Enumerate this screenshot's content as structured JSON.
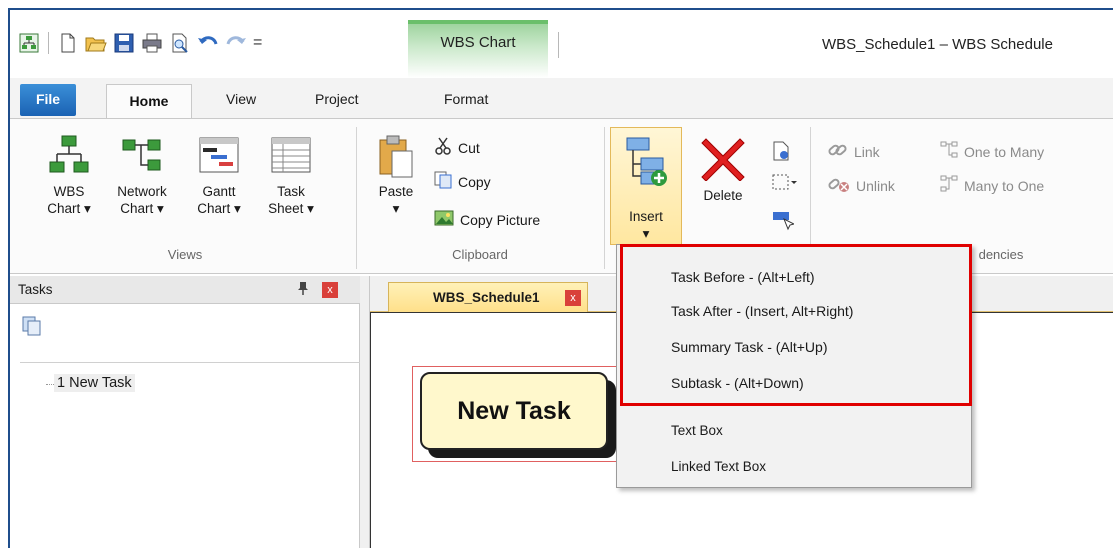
{
  "window": {
    "context_tab": "WBS Chart",
    "title": "WBS_Schedule1 – WBS Schedule"
  },
  "quick_access": {
    "icons": [
      "app-icon",
      "new-icon",
      "open-icon",
      "save-icon",
      "print-icon",
      "print-preview-icon",
      "undo-icon",
      "redo-icon"
    ],
    "more": "="
  },
  "ribbon_tabs": {
    "file": "File",
    "home": "Home",
    "view": "View",
    "project": "Project",
    "format": "Format"
  },
  "views_group": {
    "label": "Views",
    "wbs_chart": [
      "WBS",
      "Chart ▾"
    ],
    "network_chart": [
      "Network",
      "Chart ▾"
    ],
    "gantt_chart": [
      "Gantt",
      "Chart ▾"
    ],
    "task_sheet": [
      "Task",
      "Sheet ▾"
    ]
  },
  "clipboard_group": {
    "label": "Clipboard",
    "paste": "Paste",
    "paste_arrow": "▾",
    "cut": "Cut",
    "copy": "Copy",
    "copy_picture": "Copy Picture"
  },
  "insert_group": {
    "insert": "Insert",
    "insert_arrow": "▾",
    "delete": "Delete"
  },
  "dependencies_group": {
    "label": "dencies",
    "link": "Link",
    "unlink": "Unlink",
    "one_to_many": "One to Many",
    "many_to_one": "Many to One"
  },
  "tasks_panel": {
    "title": "Tasks",
    "pin": "ᵩ",
    "close": "x",
    "items": [
      "1 New Task"
    ]
  },
  "document": {
    "tab_label": "WBS_Schedule1",
    "tab_close": "x",
    "node_label": "New Task"
  },
  "insert_menu": {
    "items": [
      "Task Before  -  (Alt+Left)",
      "Task After  -  (Insert, Alt+Right)",
      "Summary Task  -  (Alt+Up)",
      "Subtask  -  (Alt+Down)",
      "Text Box",
      "Linked Text Box"
    ],
    "highlight_color": "#e00000"
  },
  "colors": {
    "file_tab": "#1a62b3",
    "context_tab": "#6bbf6b",
    "active_doc_tab": "#ffe08a",
    "node_fill": "#fff8cc"
  }
}
